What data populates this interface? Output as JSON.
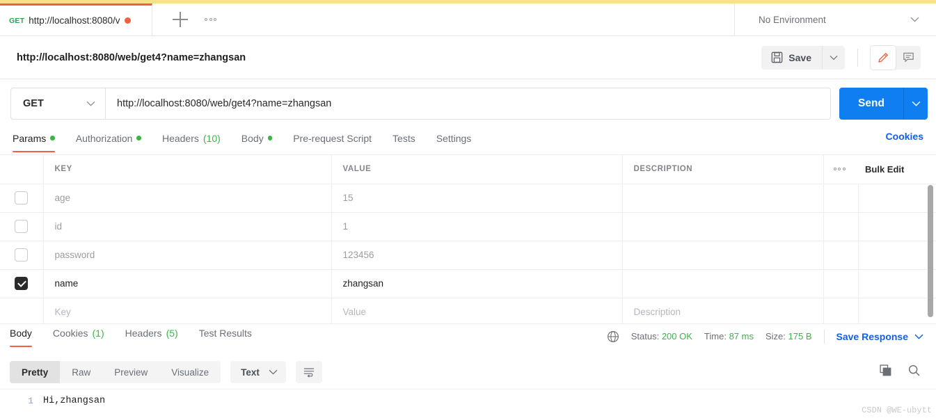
{
  "theme": {
    "accent_orange": "#f0603c",
    "accent_blue": "#0f7ef0",
    "link_blue": "#1060e8",
    "green": "#3bb54a",
    "top_strip": "#fbe08a"
  },
  "tabbar": {
    "tab_method": "GET",
    "tab_title": "http://localhost:8080/v",
    "new_tab_icon": "plus-icon",
    "more_icon": "ellipsis-icon",
    "environment": "No Environment",
    "environment_caret_icon": "chevron-down-icon"
  },
  "title_row": {
    "request_title": "http://localhost:8080/web/get4?name=zhangsan",
    "save_label": "Save",
    "save_icon": "floppy-disk-icon",
    "save_caret_icon": "chevron-down-icon",
    "edit_icon": "pencil-icon",
    "comment_icon": "comment-icon"
  },
  "url_row": {
    "method": "GET",
    "method_caret_icon": "chevron-down-icon",
    "url": "http://localhost:8080/web/get4?name=zhangsan",
    "send_label": "Send",
    "send_caret_icon": "chevron-down-icon"
  },
  "request_tabs": {
    "items": [
      {
        "label": "Params",
        "active": true,
        "dot": true,
        "count": ""
      },
      {
        "label": "Authorization",
        "active": false,
        "dot": true,
        "count": ""
      },
      {
        "label": "Headers",
        "active": false,
        "dot": false,
        "count": "(10)"
      },
      {
        "label": "Body",
        "active": false,
        "dot": true,
        "count": ""
      },
      {
        "label": "Pre-request Script",
        "active": false,
        "dot": false,
        "count": ""
      },
      {
        "label": "Tests",
        "active": false,
        "dot": false,
        "count": ""
      },
      {
        "label": "Settings",
        "active": false,
        "dot": false,
        "count": ""
      }
    ],
    "cookies_link": "Cookies"
  },
  "params_table": {
    "headers": {
      "key": "KEY",
      "value": "VALUE",
      "description": "DESCRIPTION",
      "actions_icon": "ellipsis-icon",
      "bulk_edit": "Bulk Edit"
    },
    "rows": [
      {
        "checked": false,
        "key": "age",
        "value": "15",
        "description": ""
      },
      {
        "checked": false,
        "key": "id",
        "value": "1",
        "description": ""
      },
      {
        "checked": false,
        "key": "password",
        "value": "123456",
        "description": ""
      },
      {
        "checked": true,
        "key": "name",
        "value": "zhangsan",
        "description": ""
      }
    ],
    "placeholder_row": {
      "key": "Key",
      "value": "Value",
      "description": "Description"
    }
  },
  "response": {
    "tabs": [
      {
        "label": "Body",
        "active": true,
        "count": ""
      },
      {
        "label": "Cookies",
        "active": false,
        "count": "(1)"
      },
      {
        "label": "Headers",
        "active": false,
        "count": "(5)"
      },
      {
        "label": "Test Results",
        "active": false,
        "count": ""
      }
    ],
    "globe_icon": "globe-icon",
    "status_label": "Status:",
    "status_value": "200 OK",
    "time_label": "Time:",
    "time_value": "87 ms",
    "size_label": "Size:",
    "size_value": "175 B",
    "save_response": "Save Response",
    "save_response_caret_icon": "chevron-down-icon",
    "view_modes": [
      {
        "label": "Pretty",
        "active": true
      },
      {
        "label": "Raw",
        "active": false
      },
      {
        "label": "Preview",
        "active": false
      },
      {
        "label": "Visualize",
        "active": false
      }
    ],
    "format": "Text",
    "format_caret_icon": "chevron-down-icon",
    "wrap_icon": "word-wrap-icon",
    "copy_icon": "copy-icon",
    "search_icon": "search-icon",
    "body_lines": [
      {
        "number": "1",
        "text": "Hi,zhangsan"
      }
    ]
  },
  "watermark": "CSDN @WE-ubytt"
}
